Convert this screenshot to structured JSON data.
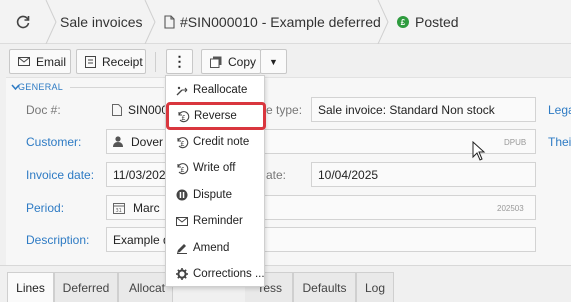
{
  "breadcrumb": {
    "section": "Sale invoices",
    "document": "#SIN000010 - Example deferred",
    "status": "Posted"
  },
  "toolbar": {
    "email": "Email",
    "receipt": "Receipt",
    "more": "⋮",
    "copy": "Copy",
    "copy_arrow": "▼"
  },
  "form": {
    "section_title": "GENERAL",
    "doc_label": "Doc #:",
    "doc_value": "SIN000",
    "type_label": "e type:",
    "type_value": "Sale invoice: Standard Non stock",
    "legal_link": "Lega",
    "customer_label": "Customer:",
    "customer_value": "Dover",
    "customer_hint": "DPUB",
    "their_link": "Thei",
    "invoice_date_label": "Invoice date:",
    "invoice_date_value": "11/03/202",
    "due_label": "ate:",
    "due_value": "10/04/2025",
    "period_label": "Period:",
    "period_value": "Marc",
    "period_hint": "202503",
    "description_label": "Description:",
    "description_value": "Example d"
  },
  "tabs": [
    "Lines",
    "Deferred",
    "Allocat",
    "ress",
    "Defaults",
    "Log"
  ],
  "menu": {
    "items": [
      "Reallocate",
      "Reverse",
      "Credit note",
      "Write off",
      "Dispute",
      "Reminder",
      "Amend",
      "Corrections ..."
    ],
    "highlighted": "Reverse"
  },
  "colors": {
    "link": "#2e7bc4",
    "posted": "#2e9b3e",
    "highlight": "#d9363e"
  }
}
